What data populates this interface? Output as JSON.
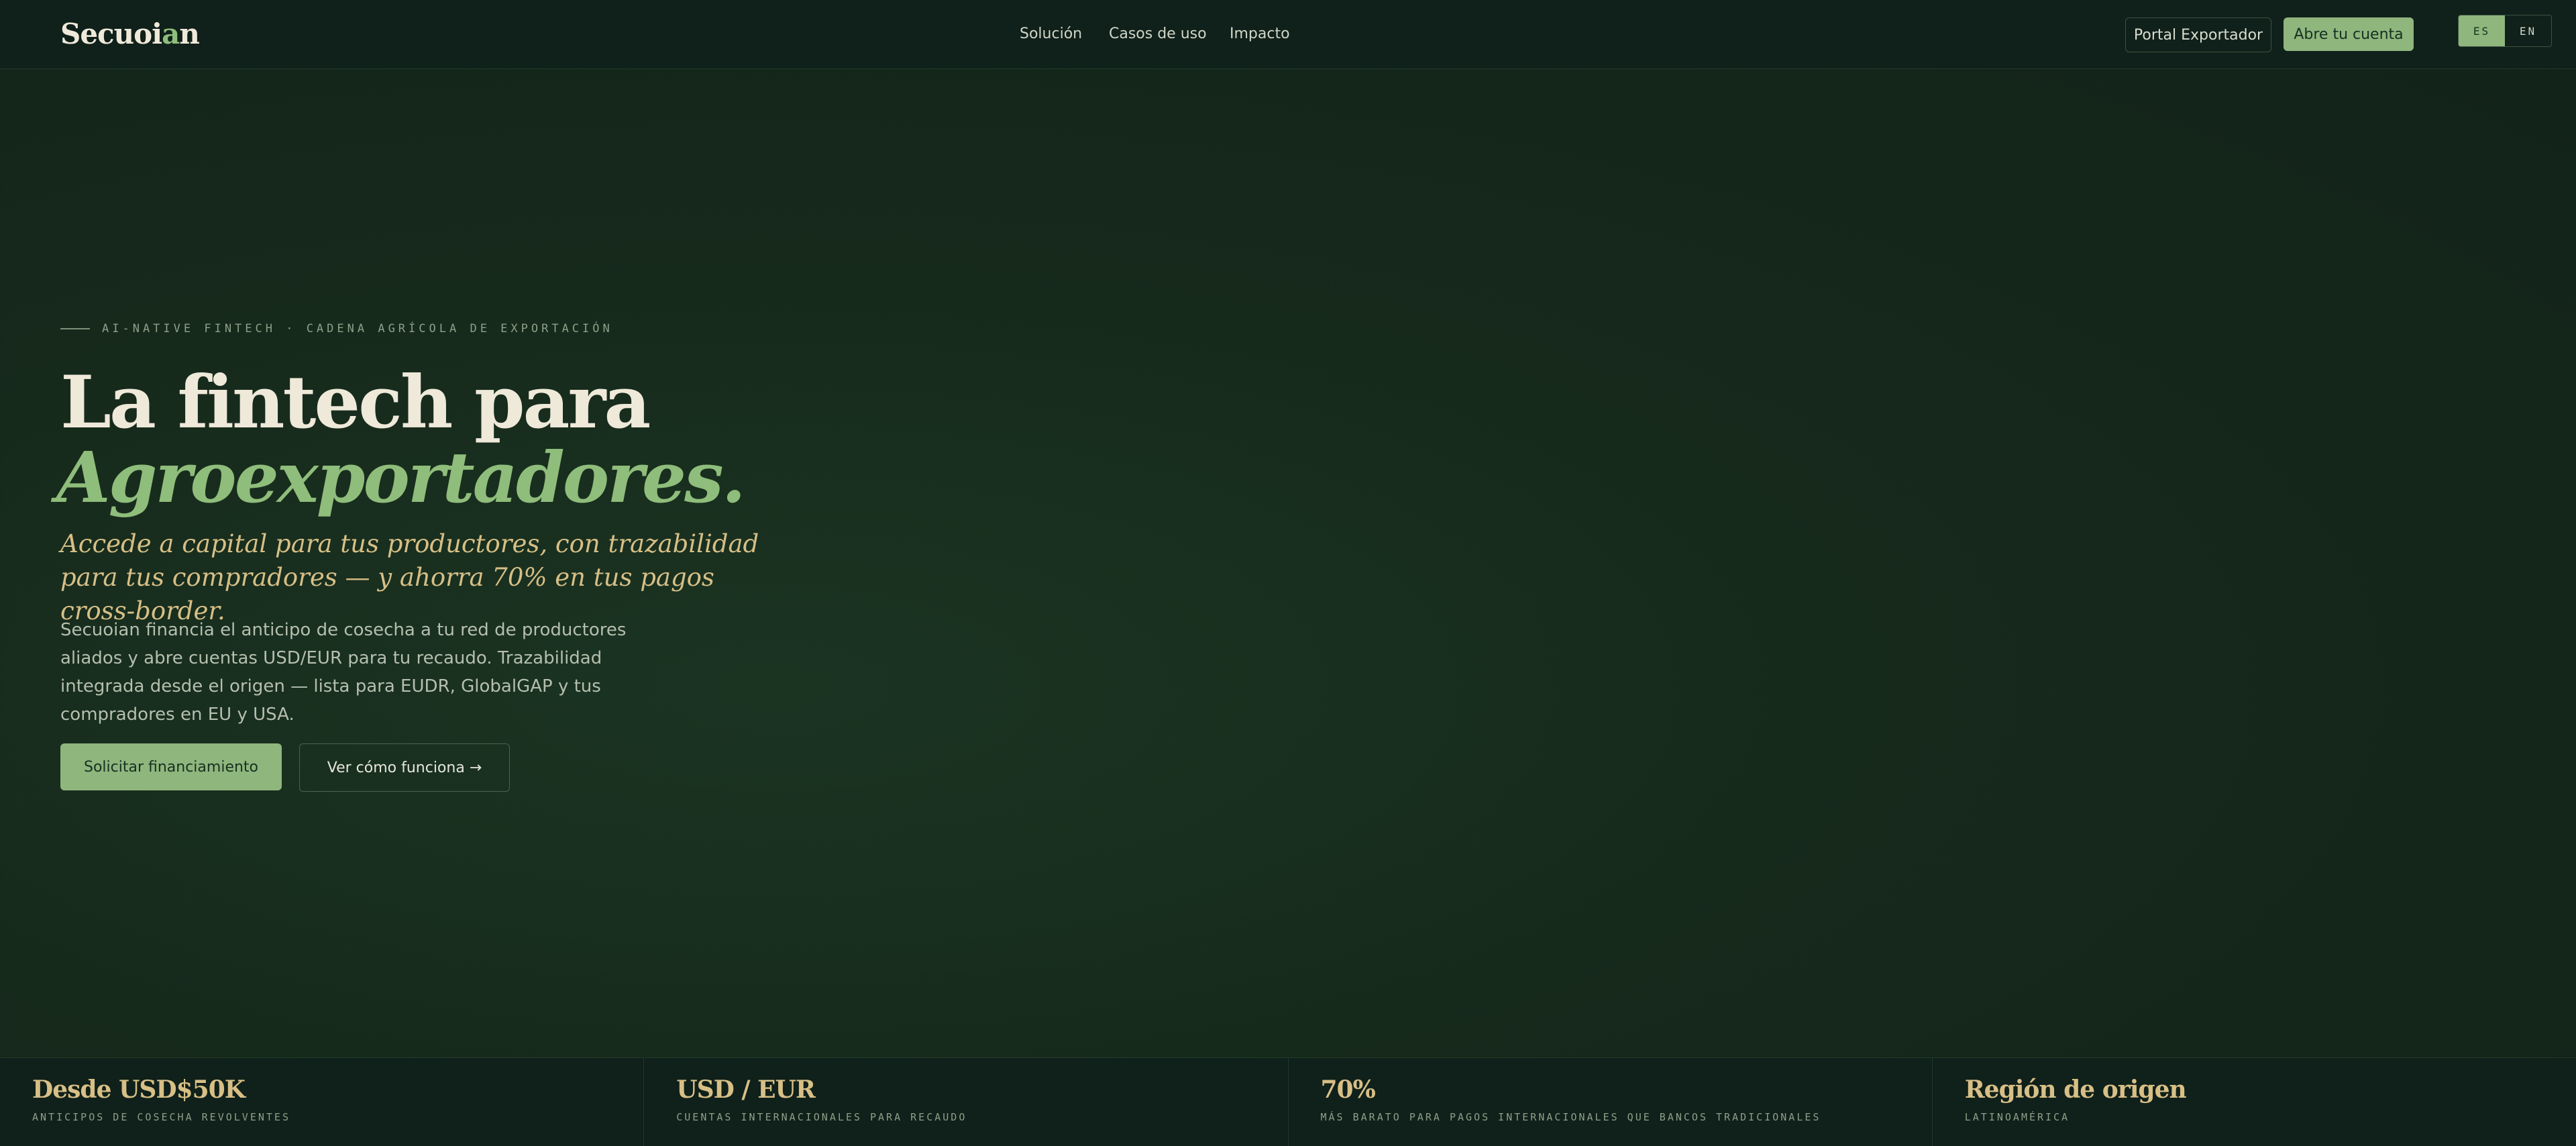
{
  "header": {
    "logo_part1": "Secuoi",
    "logo_accent": "a",
    "logo_part2": "n",
    "nav": [
      "Solución",
      "Casos de uso",
      "Impacto"
    ],
    "portal_button": "Portal Exportador",
    "open_account_button": "Abre tu cuenta",
    "lang": [
      "ES",
      "EN"
    ],
    "lang_active": "ES"
  },
  "hero": {
    "eyebrow": "AI-NATIVE FINTECH · CADENA AGRÍCOLA DE EXPORTACIÓN",
    "title_line1": "La fintech para",
    "title_line2": "Agroexportadores.",
    "subtitle": "Accede a capital para tus productores, con trazabilidad para tus compradores — y ahorra 70% en tus pagos cross-border.",
    "body": "Secuoian financia el anticipo de cosecha a tu red de productores aliados y abre cuentas USD/EUR para tu recaudo. Trazabilidad integrada desde el origen — lista para EUDR, GlobalGAP y tus compradores en EU y USA.",
    "cta_primary": "Solicitar financiamiento",
    "cta_secondary": "Ver cómo funciona →"
  },
  "stats": [
    {
      "value": "Desde USD$50K",
      "label": "ANTICIPOS DE COSECHA REVOLVENTES"
    },
    {
      "value": "USD / EUR",
      "label": "CUENTAS INTERNACIONALES PARA RECAUDO"
    },
    {
      "value": "70%",
      "label": "MÁS BARATO PARA PAGOS INTERNACIONALES QUE BANCOS TRADICIONALES"
    },
    {
      "value": "Región de origen",
      "label": "LATINOAMÉRICA"
    }
  ],
  "colors": {
    "background": "#16291b",
    "accent_green": "#8fb67d",
    "accent_gold": "#d7bf86",
    "text_light": "#efe9da"
  }
}
